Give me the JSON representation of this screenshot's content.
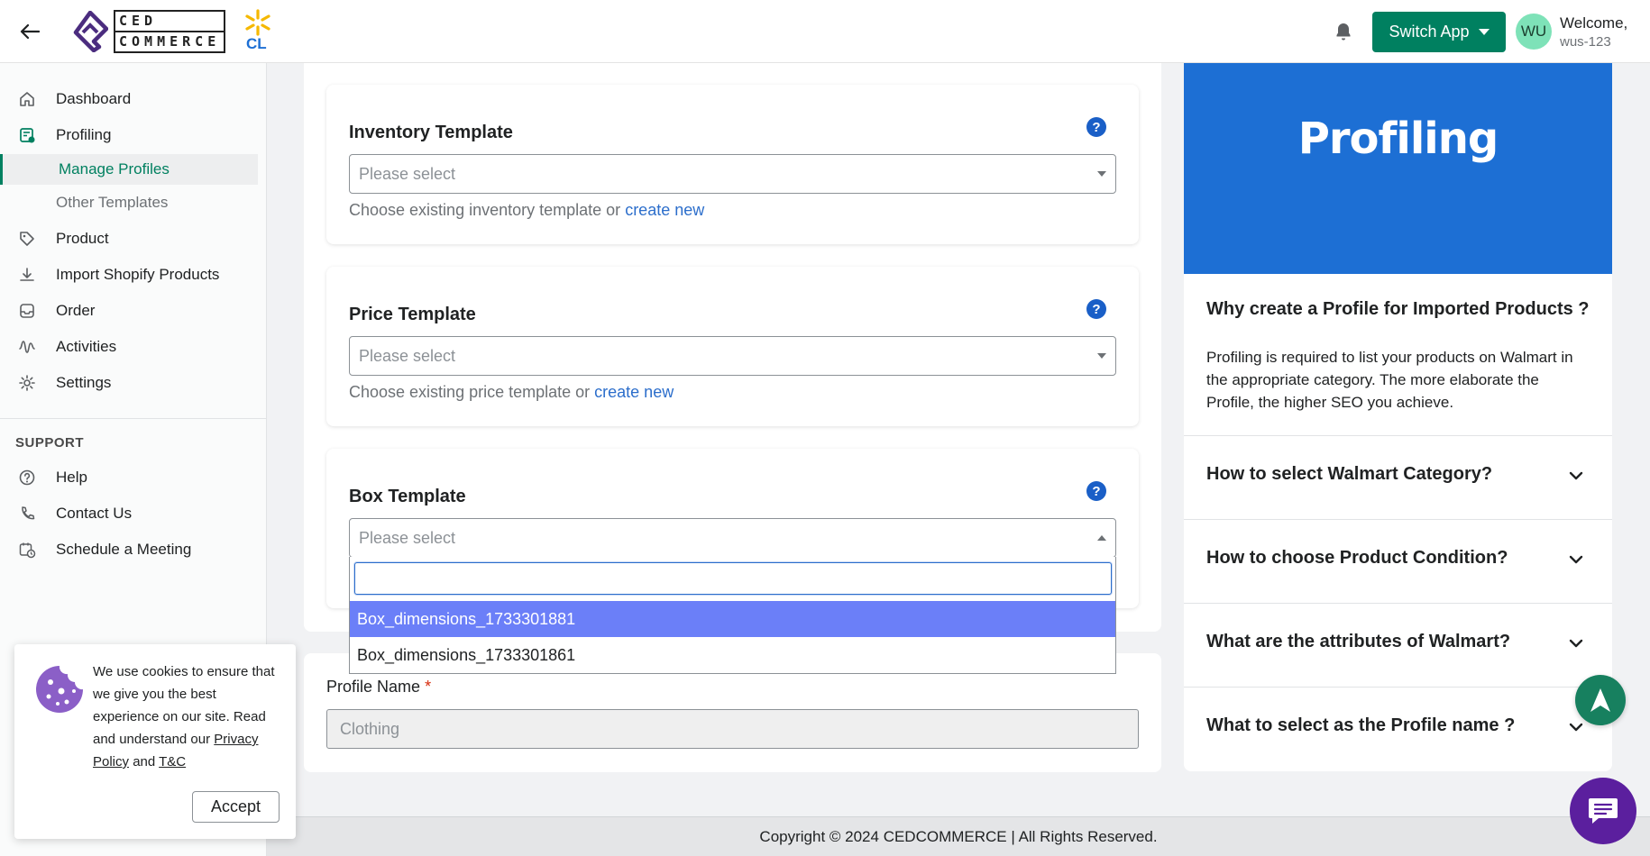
{
  "header": {
    "logo_line1": "CED",
    "logo_line2": "COMMERCE",
    "logo_badge": "CL",
    "switch_app_label": "Switch App",
    "avatar_initials": "WU",
    "welcome": "Welcome,",
    "username": "wus-123"
  },
  "sidebar": {
    "items": [
      {
        "label": "Dashboard"
      },
      {
        "label": "Profiling"
      },
      {
        "label": "Manage Profiles"
      },
      {
        "label": "Other Templates"
      },
      {
        "label": "Product"
      },
      {
        "label": "Import Shopify Products"
      },
      {
        "label": "Order"
      },
      {
        "label": "Activities"
      },
      {
        "label": "Settings"
      }
    ],
    "support_heading": "SUPPORT",
    "support_items": [
      {
        "label": "Help"
      },
      {
        "label": "Contact Us"
      },
      {
        "label": "Schedule a Meeting"
      }
    ]
  },
  "templates": {
    "inventory": {
      "title": "Inventory Template",
      "placeholder": "Please select",
      "help_prefix": "Choose existing inventory template or",
      "help_link": "create new"
    },
    "price": {
      "title": "Price Template",
      "placeholder": "Please select",
      "help_prefix": "Choose existing price template or",
      "help_link": "create new"
    },
    "box": {
      "title": "Box Template",
      "placeholder": "Please select",
      "search_value": "",
      "options": [
        "Box_dimensions_1733301881",
        "Box_dimensions_1733301861"
      ]
    },
    "help_glyph": "?"
  },
  "profile_name": {
    "label": "Profile Name",
    "required_mark": "*",
    "value": "Clothing"
  },
  "right_panel": {
    "banner_title": "Profiling",
    "faq_open_question": "Why create a Profile for Imported Products ?",
    "faq_open_answer": "Profiling is required to list your products on Walmart in the appropriate category. The more elaborate the Profile, the higher SEO you achieve.",
    "faq_items": [
      "How to select Walmart Category?",
      "How to choose Product Condition?",
      "What are the attributes of Walmart?",
      "What to select as the Profile name ?"
    ]
  },
  "cookie": {
    "text_prefix": "We use cookies to ensure that we give you the best experience on our site. Read and understand our",
    "privacy_link": "Privacy Policy",
    "and": "and",
    "tc_link": "T&C",
    "accept_label": "Accept"
  },
  "footer": {
    "copyright": "Copyright © 2024 CEDCOMMERCE | All Rights Reserved."
  },
  "colors": {
    "primary_green": "#008060",
    "banner_blue": "#1d6fd4",
    "help_blue": "#1a5fc7",
    "option_highlight": "#6b7ff8",
    "chat_purple": "#5b1f9e"
  },
  "icons": {
    "back": "arrow-left-icon",
    "bell": "bell-icon",
    "dashboard": "home-icon",
    "profiling": "profile-icon",
    "product": "tag-icon",
    "import": "download-icon",
    "order": "inbox-icon",
    "activities": "activity-icon",
    "settings": "gear-icon",
    "help": "question-circle-icon",
    "contact": "phone-icon",
    "schedule": "calendar-clock-icon",
    "scroll_top": "arrow-up-icon",
    "chat": "chat-icon",
    "cookie": "cookie-icon"
  }
}
